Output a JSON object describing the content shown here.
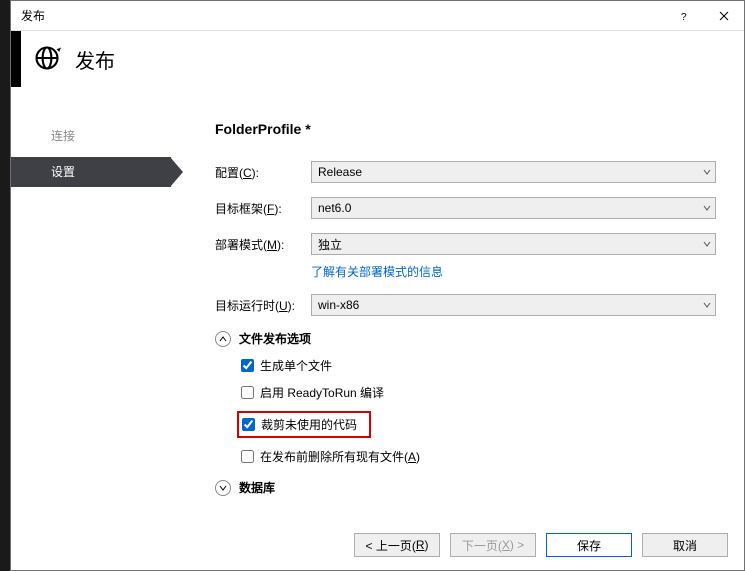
{
  "titlebar": {
    "title": "发布"
  },
  "header": {
    "title": "发布"
  },
  "sidebar": {
    "items": [
      {
        "label": "连接",
        "active": false
      },
      {
        "label": "设置",
        "active": true
      }
    ]
  },
  "profile": {
    "name": "FolderProfile *"
  },
  "fields": {
    "config": {
      "label_pre": "配置(",
      "hot": "C",
      "label_post": "):",
      "value": "Release"
    },
    "target": {
      "label_pre": "目标框架(",
      "hot": "F",
      "label_post": "):",
      "value": "net6.0"
    },
    "mode": {
      "label_pre": "部署模式(",
      "hot": "M",
      "label_post": "):",
      "value": "独立",
      "info_link": "了解有关部署模式的信息"
    },
    "runtime": {
      "label_pre": "目标运行时(",
      "hot": "U",
      "label_post": "):",
      "value": "win-x86"
    }
  },
  "sections": {
    "file_options": {
      "title": "文件发布选项",
      "single_file": {
        "label": "生成单个文件",
        "checked": true
      },
      "ready_to_run": {
        "label": "启用 ReadyToRun 编译",
        "checked": false
      },
      "trim_unused": {
        "label": "裁剪未使用的代码",
        "checked": true
      },
      "delete_existing": {
        "label_pre": "在发布前删除所有现有文件(",
        "hot": "A",
        "label_post": ")",
        "checked": false
      }
    },
    "database": {
      "title": "数据库"
    }
  },
  "footer": {
    "prev": {
      "label_pre": "< 上一页(",
      "hot": "R",
      "label_post": ")"
    },
    "next": {
      "label_pre": "下一页(",
      "hot": "X",
      "label_post": ") >"
    },
    "save": {
      "label": "保存"
    },
    "cancel": {
      "label": "取消"
    }
  }
}
